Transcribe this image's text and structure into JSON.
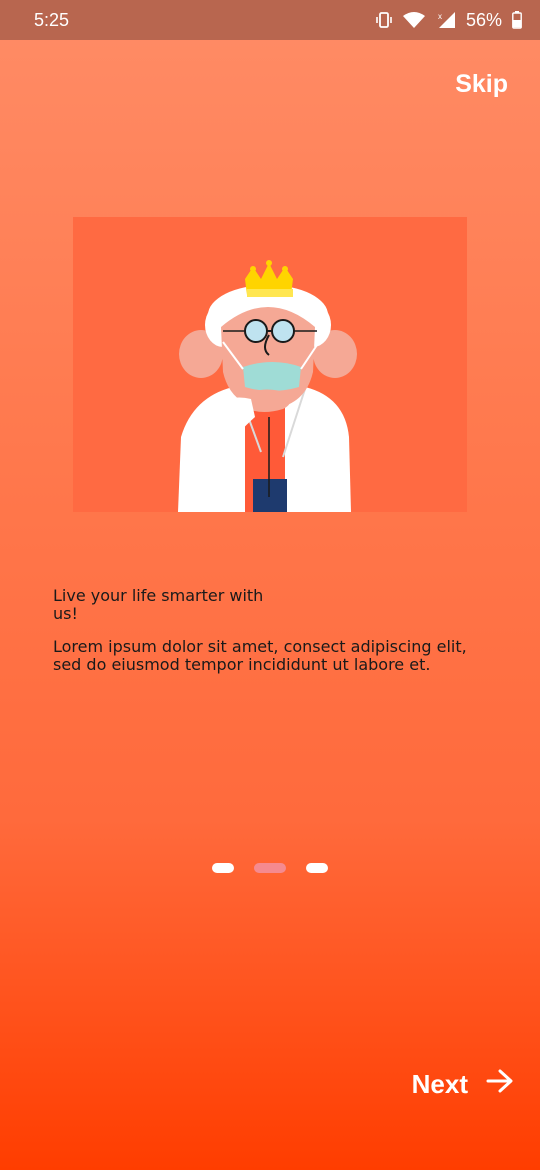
{
  "status_bar": {
    "time": "5:25",
    "battery": "56%",
    "icons": [
      "vibrate-icon",
      "wifi-icon",
      "signal-icon",
      "battery-icon"
    ]
  },
  "skip_label": "Skip",
  "onboarding": {
    "title": "Live your life smarter with us!",
    "body": "Lorem ipsum dolor sit amet, consect adipiscing elit, sed do eiusmod tempor incididunt ut labore et.",
    "total_pages": 3,
    "active_page": 2
  },
  "next_label": "Next",
  "colors": {
    "background_top": "#ff8c66",
    "background_bottom": "#ff3d00",
    "illustration_bg": "#ff6a42",
    "active_dot": "#f58a8f",
    "inactive_dot": "#ffffff"
  }
}
